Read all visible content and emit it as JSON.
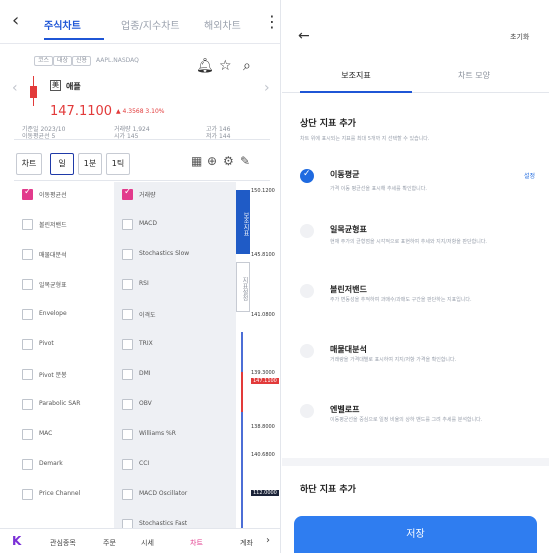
{
  "left": {
    "tabs": [
      "주식차트",
      "업종/지수차트",
      "해외차트"
    ],
    "badges": [
      "코스",
      "대상",
      "신용"
    ],
    "stock_code": "AAPL.NASDAQ",
    "stock_box": "美",
    "stock_name": "애플",
    "price": "147.1100",
    "change": "▲ 4.3568 3.10%",
    "info_row1": [
      "기준일 2023/10",
      "거래량 1,924",
      "고가 146"
    ],
    "info_row2": [
      "이동평균선 5",
      "시가 145",
      "저가 144"
    ],
    "period_buttons": [
      "차트",
      "일",
      "1분",
      "1틱"
    ],
    "toolbar_icons": [
      "grid-icon",
      "zoom-in-icon",
      "settings-icon",
      "brush-icon"
    ],
    "overlay_indicators": [
      {
        "label": "이동평균선",
        "checked": true
      },
      {
        "label": "볼린저밴드",
        "checked": false
      },
      {
        "label": "매물대분석",
        "checked": false
      },
      {
        "label": "일목균형표",
        "checked": false
      },
      {
        "label": "Envelope",
        "checked": false
      },
      {
        "label": "Pivot",
        "checked": false
      },
      {
        "label": "Pivot 분봉",
        "checked": false
      },
      {
        "label": "Parabolic SAR",
        "checked": false
      },
      {
        "label": "MAC",
        "checked": false
      },
      {
        "label": "Demark",
        "checked": false
      },
      {
        "label": "Price Channel",
        "checked": false
      }
    ],
    "sub_indicators": [
      {
        "label": "거래량",
        "checked": true
      },
      {
        "label": "MACD",
        "checked": false
      },
      {
        "label": "Stochastics Slow",
        "checked": false
      },
      {
        "label": "RSI",
        "checked": false
      },
      {
        "label": "이격도",
        "checked": false
      },
      {
        "label": "TRIX",
        "checked": false
      },
      {
        "label": "DMI",
        "checked": false
      },
      {
        "label": "OBV",
        "checked": false
      },
      {
        "label": "Williams %R",
        "checked": false
      },
      {
        "label": "CCI",
        "checked": false
      },
      {
        "label": "MACD Oscillator",
        "checked": false
      },
      {
        "label": "Stochastics Fast",
        "checked": false
      }
    ],
    "chart_tabs": [
      "보조지표",
      "지표설정"
    ],
    "price_ticks": [
      {
        "text": "150.1200",
        "style": "normal"
      },
      {
        "text": "145.8100",
        "style": "normal"
      },
      {
        "text": "141.0800",
        "style": "normal"
      },
      {
        "text": "139.3000",
        "style": "normal"
      },
      {
        "text": "147.1100",
        "style": "red"
      },
      {
        "text": "138.8000",
        "style": "normal"
      },
      {
        "text": "140.6800",
        "style": "normal"
      },
      {
        "text": "112.0000",
        "style": "dark"
      }
    ],
    "bottom_nav": [
      "관심종목",
      "주문",
      "시세",
      "차트",
      "계좌"
    ],
    "bottom_nav_active": 3
  },
  "right": {
    "reset_label": "초기화",
    "tabs": [
      "보조지표",
      "차트 모양"
    ],
    "top_section_title": "상단 지표 추가",
    "top_section_desc": "차트 위에 표시되는 지표를 최대 5개까 지 선택할 수 있습니다.",
    "indicators": [
      {
        "name": "이동평균",
        "desc": "가격 이동 평균선을 표시해 추세를 확인합니다.",
        "selected": true,
        "setting": "설정"
      },
      {
        "name": "일목균형표",
        "desc": "현재 주가의 균형점을 시각적으로 표현하여 추세와 지지/저항을 판단합니다.",
        "selected": false,
        "setting": ""
      },
      {
        "name": "볼린저밴드",
        "desc": "주가 변동성을 추적하여 과매수/과매도 구간을 판단하는 지표입니다.",
        "selected": false,
        "setting": ""
      },
      {
        "name": "매물대분석",
        "desc": "거래량을 가격대별로 표시하여 지지/저항 가격을 확인합니다.",
        "selected": false,
        "setting": ""
      },
      {
        "name": "엔벨로프",
        "desc": "이동평균선을 중심으로 일정 비율의 상하 밴드를 그려 추세를 분석합니다.",
        "selected": false,
        "setting": ""
      }
    ],
    "bottom_section_title": "하단 지표 추가",
    "save_label": "저장"
  }
}
